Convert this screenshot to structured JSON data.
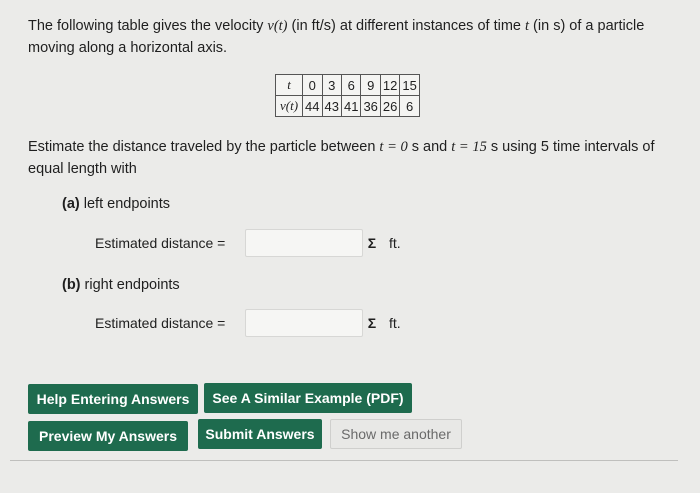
{
  "question": {
    "intro_part1": "The following table gives the velocity ",
    "intro_var_v": "v(t)",
    "intro_part2": " (in ft/s) at different instances of time ",
    "intro_var_t": "t",
    "intro_part3": " (in s) of a particle moving along a horizontal axis.",
    "table": {
      "row_t_label": "t",
      "row_v_label": "v(t)",
      "t_values": [
        "0",
        "3",
        "6",
        "9",
        "12",
        "15"
      ],
      "v_values": [
        "44",
        "43",
        "41",
        "36",
        "26",
        "6"
      ]
    },
    "estimate_part1": "Estimate the distance traveled by the particle between ",
    "estimate_t1": "t = 0",
    "estimate_part2": " s and ",
    "estimate_t2": "t = 15",
    "estimate_part3": " s using 5 time intervals of equal length with",
    "part_a_label": "(a)",
    "part_a_text": " left endpoints",
    "part_b_label": "(b)",
    "part_b_text": " right endpoints",
    "answer_label": "Estimated distance =",
    "sigma_glyph": "Σ",
    "unit": "ft.",
    "answer_a_value": "",
    "answer_b_value": ""
  },
  "buttons": {
    "help": "Help Entering Answers",
    "similar": "See A Similar Example (PDF)",
    "preview": "Preview My Answers",
    "submit": "Submit Answers",
    "show_another": "Show me another"
  },
  "colors": {
    "accent": "#1e6b4e",
    "background": "#ebebe9"
  }
}
